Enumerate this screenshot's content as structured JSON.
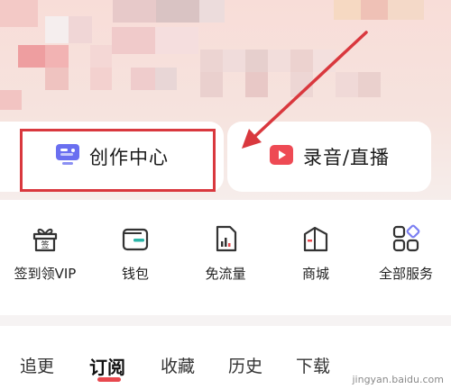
{
  "header": {
    "profile_area": "blurred-profile"
  },
  "action_cards": [
    {
      "label": "创作中心",
      "icon": "creator-center-icon"
    },
    {
      "label": "录音/直播",
      "icon": "record-live-icon"
    }
  ],
  "services": [
    {
      "label": "签到领VIP",
      "icon": "gift-box-sign-icon"
    },
    {
      "label": "钱包",
      "icon": "wallet-icon"
    },
    {
      "label": "免流量",
      "icon": "data-free-icon"
    },
    {
      "label": "商城",
      "icon": "mall-icon"
    },
    {
      "label": "全部服务",
      "icon": "all-services-icon"
    }
  ],
  "tabs": [
    {
      "label": "追更",
      "active": false
    },
    {
      "label": "订阅",
      "active": true
    },
    {
      "label": "收藏",
      "active": false
    },
    {
      "label": "历史",
      "active": false
    },
    {
      "label": "下载",
      "active": false
    }
  ],
  "colors": {
    "accent": "#e8484e",
    "annotation": "#d9383e",
    "creator_icon": "#6a6ff0"
  },
  "watermark": {
    "text": "jingyan.baidu.com"
  }
}
